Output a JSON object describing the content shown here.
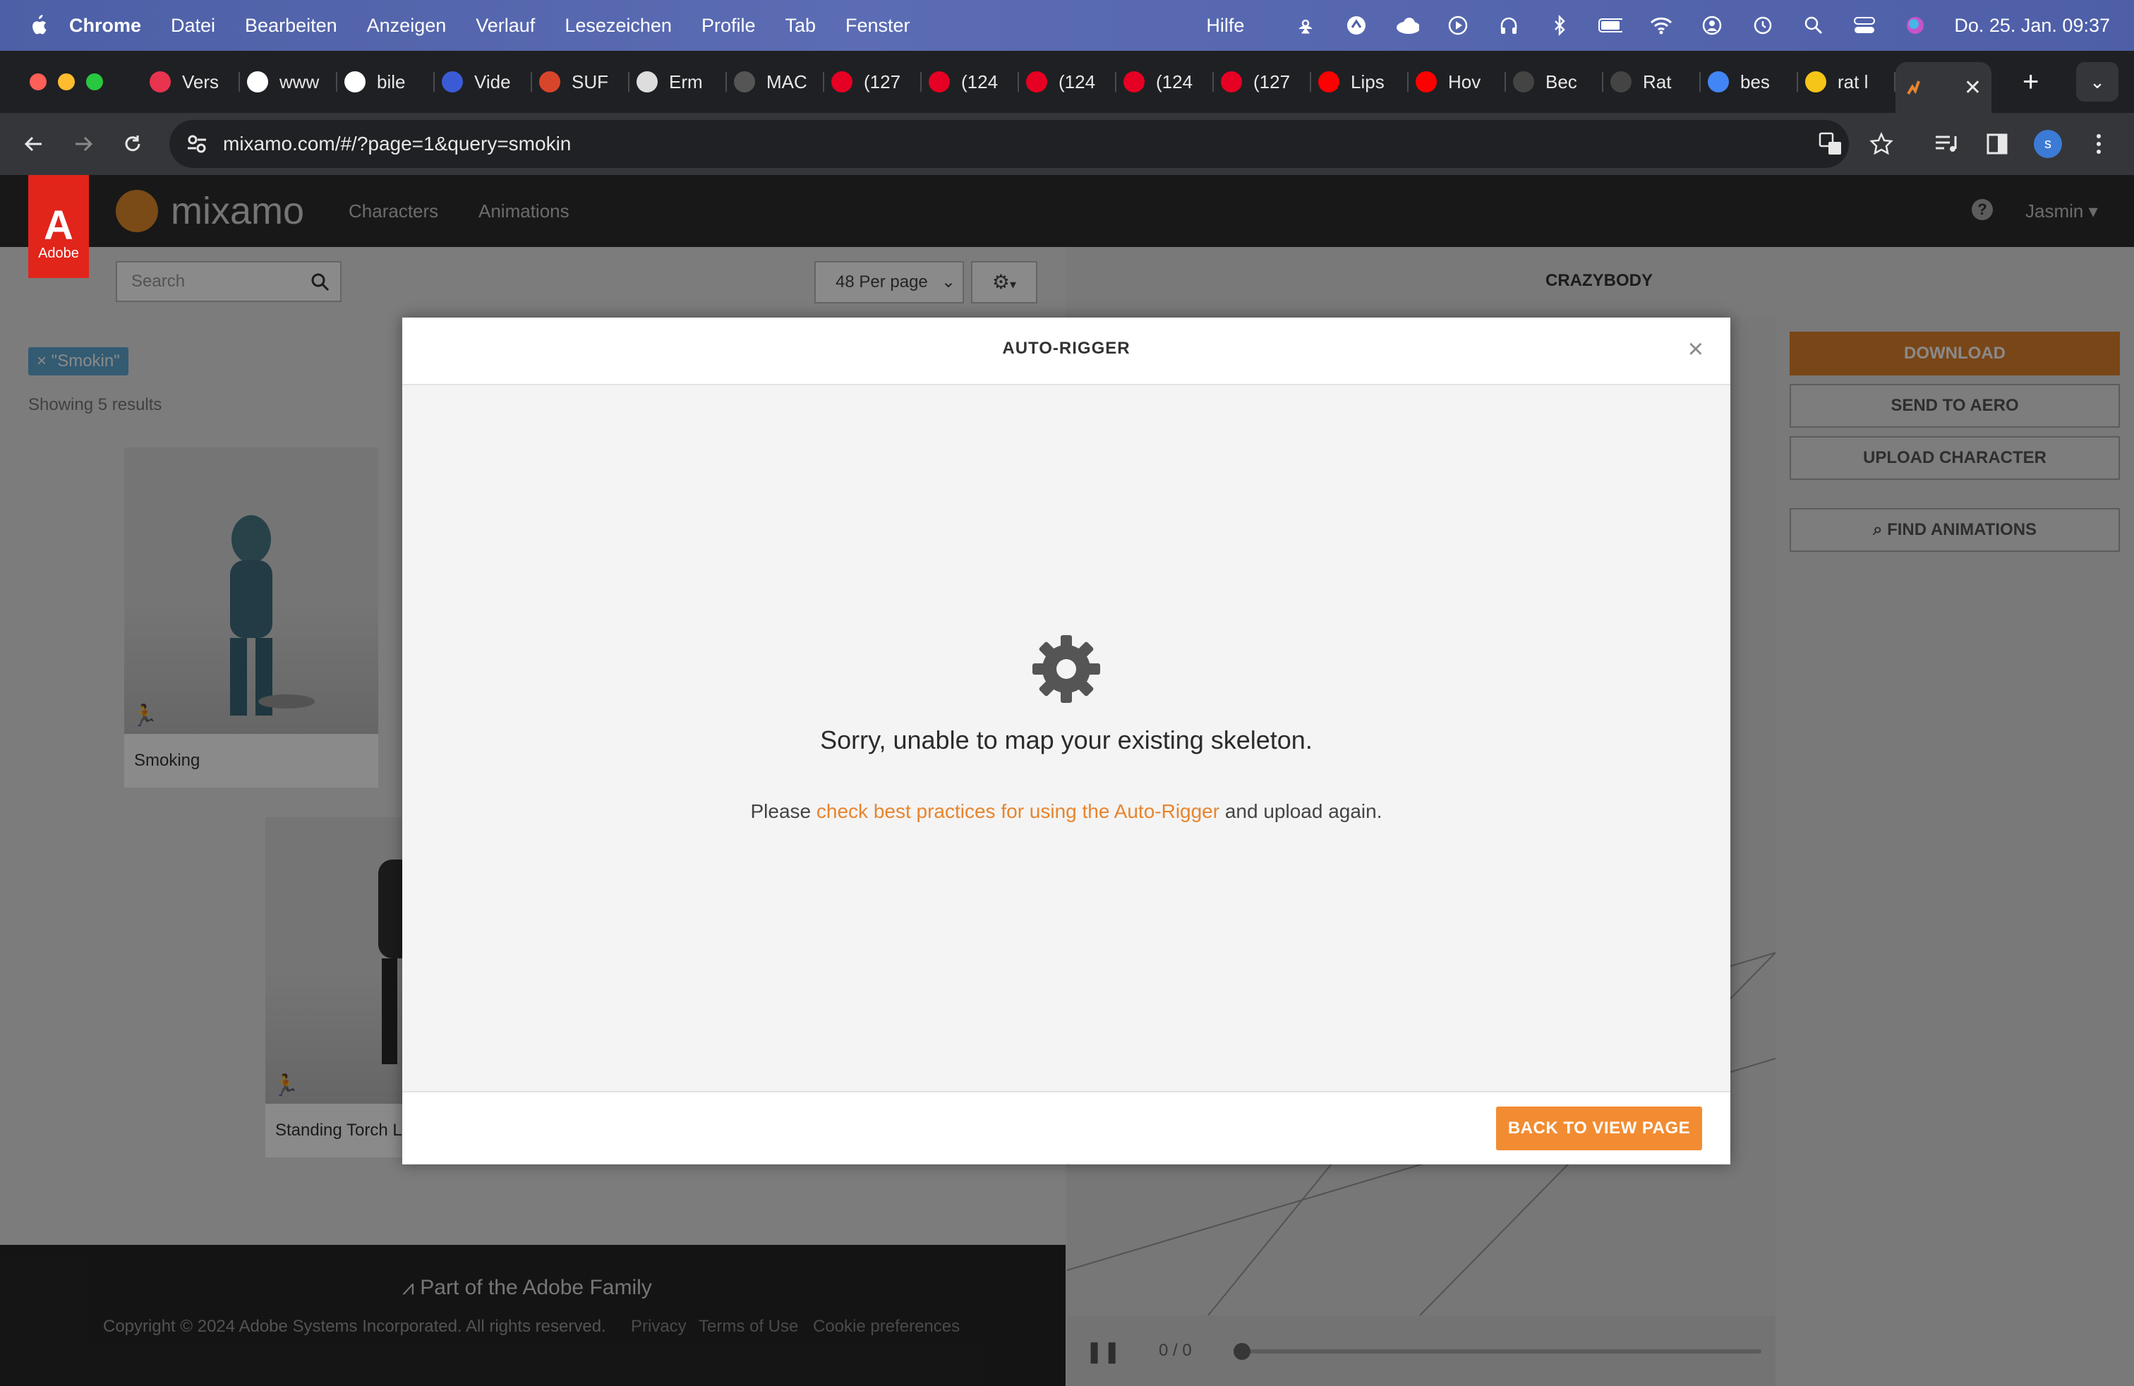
{
  "menubar": {
    "app": "Chrome",
    "items": [
      "Datei",
      "Bearbeiten",
      "Anzeigen",
      "Verlauf",
      "Lesezeichen",
      "Profile",
      "Tab",
      "Fenster"
    ],
    "help": "Hilfe",
    "clock": "Do. 25. Jan. 09:37"
  },
  "tabs": [
    {
      "label": "Vers",
      "fav_color": "#e8344e",
      "icon": "p-logo-icon"
    },
    {
      "label": "www",
      "fav_color": "#ffffff",
      "icon": "procreate-icon"
    },
    {
      "label": "bile",
      "fav_color": "#ffffff",
      "icon": "procreate-icon"
    },
    {
      "label": "Vide",
      "fav_color": "#3b5bd6",
      "icon": "video-icon"
    },
    {
      "label": "SUF",
      "fav_color": "#d9452b",
      "icon": "shoe-icon"
    },
    {
      "label": "Erm",
      "fav_color": "#dddddd",
      "icon": "apple-icon"
    },
    {
      "label": "MAC",
      "fav_color": "#555555",
      "icon": "mac-icon"
    },
    {
      "label": "(127",
      "fav_color": "#e60023",
      "icon": "pinterest-icon"
    },
    {
      "label": "(124",
      "fav_color": "#e60023",
      "icon": "pinterest-icon"
    },
    {
      "label": "(124",
      "fav_color": "#e60023",
      "icon": "pinterest-icon"
    },
    {
      "label": "(124",
      "fav_color": "#e60023",
      "icon": "pinterest-icon"
    },
    {
      "label": "(127",
      "fav_color": "#e60023",
      "icon": "pinterest-icon"
    },
    {
      "label": "Lips",
      "fav_color": "#ff0000",
      "icon": "youtube-icon"
    },
    {
      "label": "Hov",
      "fav_color": "#ff0000",
      "icon": "youtube-icon"
    },
    {
      "label": "Bec",
      "fav_color": "#444444",
      "icon": "behance-icon"
    },
    {
      "label": "Rat",
      "fav_color": "#444444",
      "icon": "rat-icon"
    },
    {
      "label": "bes",
      "fav_color": "#4285f4",
      "icon": "google-icon"
    },
    {
      "label": "rat l",
      "fav_color": "#f5c518",
      "icon": "m-logo-icon"
    }
  ],
  "active_tab": {
    "icon": "mixamo-icon"
  },
  "address": {
    "url": "mixamo.com/#/?page=1&query=smokin"
  },
  "mixamo": {
    "logo_text": "mixamo",
    "adobe_label": "Adobe",
    "nav": [
      "Characters",
      "Animations"
    ],
    "user": "Jasmin",
    "search_placeholder": "Search",
    "per_page": "48 Per page",
    "character_name": "CRAZYBODY",
    "filter_tag": "× \"Smokin\"",
    "showing": "Showing 5 results",
    "cards": [
      "Smoking",
      "Standing Torch L"
    ],
    "actions": {
      "download": "DOWNLOAD",
      "send_to_aero": "SEND TO AERO",
      "upload": "UPLOAD CHARACTER",
      "find": "FIND ANIMATIONS"
    },
    "timeline": "0 / 0",
    "footer": {
      "family": "Part of the Adobe Family",
      "copyright": "Copyright © 2024 Adobe Systems Incorporated. All rights reserved.",
      "links": [
        "Privacy",
        "Terms of Use",
        "Cookie preferences"
      ]
    }
  },
  "modal": {
    "title": "AUTO-RIGGER",
    "close": "×",
    "error_title": "Sorry, unable to map your existing skeleton.",
    "msg_prefix": "Please ",
    "msg_link": "check best practices for using the Auto-Rigger",
    "msg_suffix": " and upload again.",
    "back_button": "BACK TO VIEW PAGE"
  },
  "colors": {
    "accent": "#f28c32",
    "adobe_red": "#e1251b"
  }
}
